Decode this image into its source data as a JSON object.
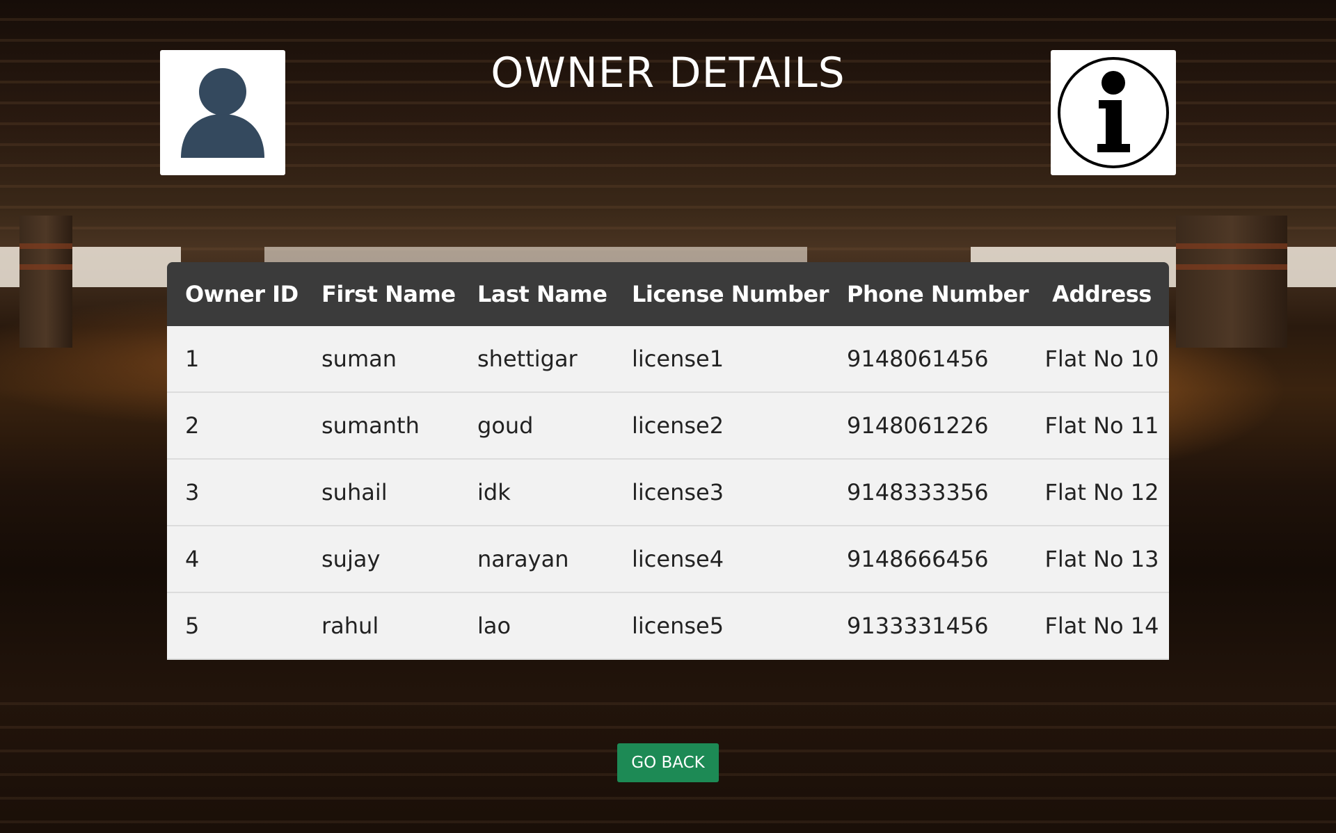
{
  "page": {
    "title": "OWNER DETAILS"
  },
  "icons": {
    "left": "user-icon",
    "right": "info-icon"
  },
  "table": {
    "columns": [
      "Owner ID",
      "First Name",
      "Last Name",
      "License Number",
      "Phone Number",
      "Address"
    ],
    "rows": [
      [
        "1",
        "suman",
        "shettigar",
        "license1",
        "9148061456",
        "Flat No 10"
      ],
      [
        "2",
        "sumanth",
        "goud",
        "license2",
        "9148061226",
        "Flat No 11"
      ],
      [
        "3",
        "suhail",
        "idk",
        "license3",
        "9148333356",
        "Flat No 12"
      ],
      [
        "4",
        "sujay",
        "narayan",
        "license4",
        "9148666456",
        "Flat No 13"
      ],
      [
        "5",
        "rahul",
        "lao",
        "license5",
        "9133331456",
        "Flat No 14"
      ]
    ]
  },
  "actions": {
    "go_back_label": "GO BACK"
  },
  "colors": {
    "header_bg": "#3b3b3b",
    "row_bg": "#f2f2f2",
    "button_bg": "#1d8a55",
    "user_icon": "#34495e"
  }
}
